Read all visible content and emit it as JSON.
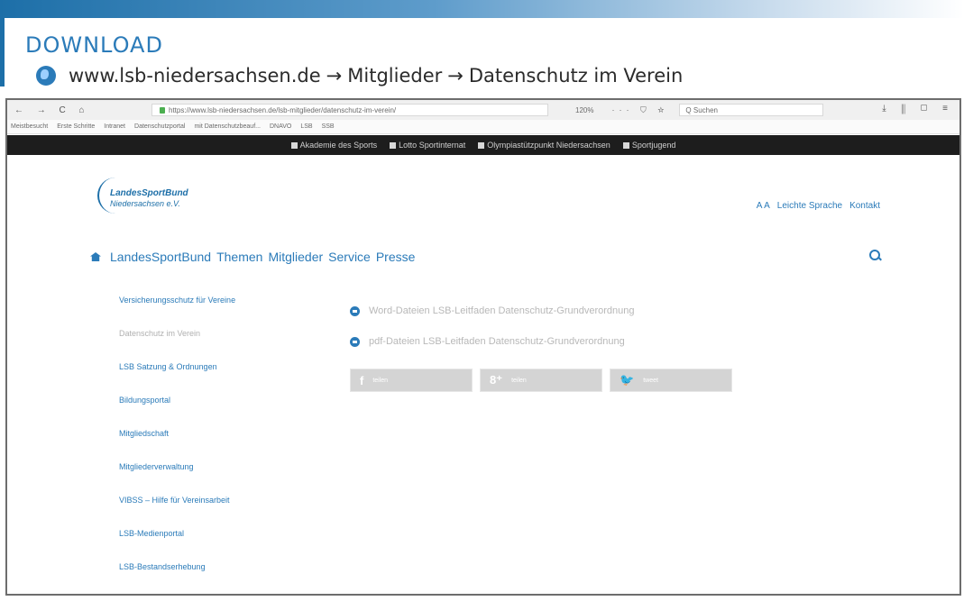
{
  "header": {
    "title": "DOWNLOAD",
    "path_url": "www.lsb-niedersachsen.de",
    "path_arrow_1": "→",
    "path_item_1": "Mitglieder",
    "path_arrow_2": "→",
    "path_item_2": "Datenschutz im Verein"
  },
  "browser": {
    "nav_glyphs": "← → C ⌂",
    "url": "https://www.lsb-niedersachsen.de/lsb-mitglieder/datenschutz-im-verein/",
    "zoom": "120%",
    "url_icons": "··· ⛉ ☆",
    "search_placeholder": "Q Suchen",
    "tool_icons": "⤓ ⫼ ▢ ≡",
    "bookmarks": [
      "Meistbesucht",
      "Erste Schritte",
      "Intranet",
      "Datenschutzportal",
      "mit Datenschutzbeauf...",
      "DNAVO",
      "LSB",
      "SSB"
    ]
  },
  "topstrip": {
    "items": [
      "Akademie des Sports",
      "Lotto Sportinternat",
      "Olympiastützpunkt Niedersachsen",
      "Sportjugend"
    ]
  },
  "site": {
    "logo_line1": "LandesSportBund",
    "logo_line2": "Niedersachsen e.V.",
    "font_size_toggle": "A A",
    "easy_language": "Leichte Sprache",
    "contact": "Kontakt",
    "nav": [
      "LandesSportBund",
      "Themen",
      "Mitglieder",
      "Service",
      "Presse"
    ]
  },
  "sidebar": {
    "items": [
      "Versicherungsschutz für Vereine",
      "Datenschutz im Verein",
      "LSB Satzung & Ordnungen",
      "Bildungsportal",
      "Mitgliedschaft",
      "Mitgliederverwaltung",
      "VIBSS – Hilfe für Vereinsarbeit",
      "LSB-Medienportal",
      "LSB-Bestandserhebung"
    ],
    "active_index": 1
  },
  "downloads": {
    "items": [
      "Word-Dateien LSB-Leitfaden Datenschutz-Grundverordnung",
      "pdf-Dateien LSB-Leitfaden Datenschutz-Grundverordnung"
    ]
  },
  "share": {
    "facebook_icon_glyph": "f",
    "facebook_label": "teilen",
    "gplus_icon_glyph": "8⁺",
    "gplus_label": "teilen",
    "twitter_icon_glyph": "🐦",
    "twitter_label": "tweet"
  },
  "colors": {
    "accent": "#2b7bb9",
    "dark_strip": "#1d1d1d",
    "share_button": "#d4d4d4"
  }
}
